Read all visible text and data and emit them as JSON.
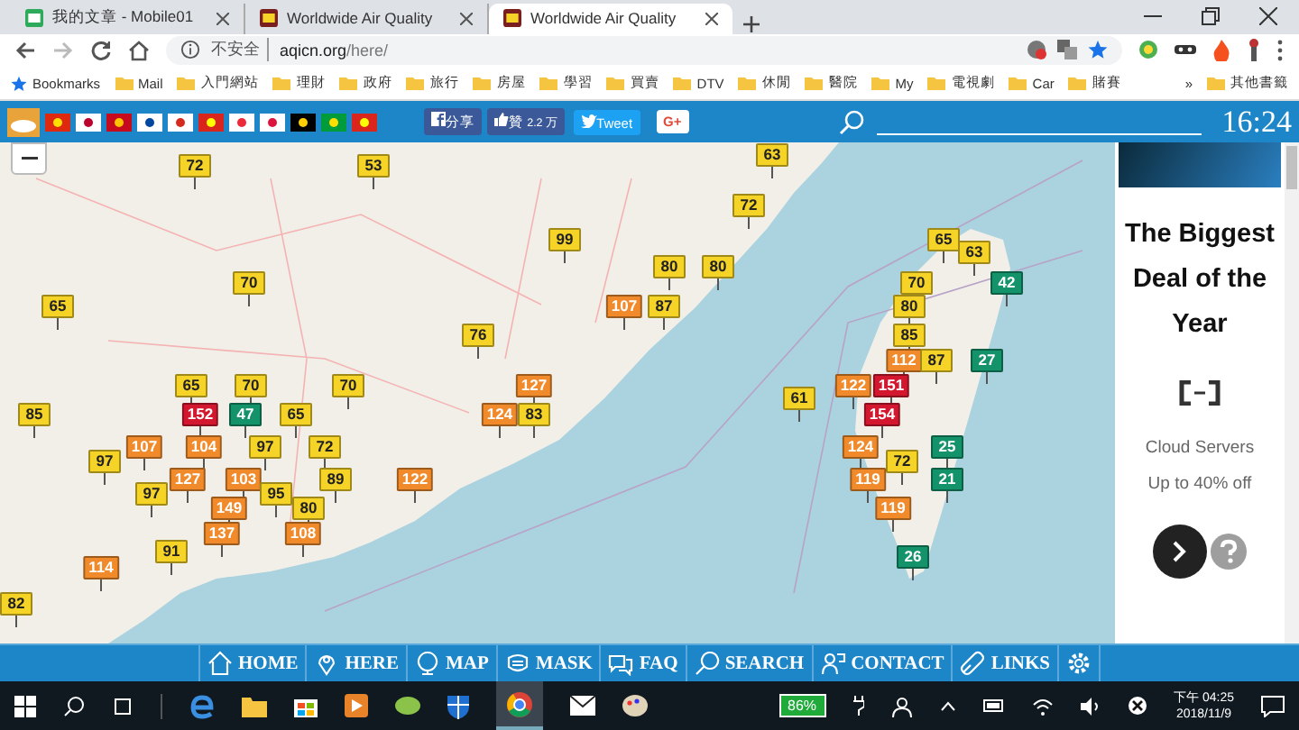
{
  "browser": {
    "tabs": [
      {
        "title": "我的文章 - Mobile01",
        "selected": false
      },
      {
        "title": "Worldwide Air Quality",
        "selected": false
      },
      {
        "title": "Worldwide Air Quality",
        "selected": true
      }
    ],
    "address": {
      "security": "不安全",
      "host": "aqicn.org",
      "path": "/here/"
    },
    "bookmarks": [
      "Mail",
      "入門網站",
      "理財",
      "政府",
      "旅行",
      "房屋",
      "學習",
      "買賣",
      "DTV",
      "休閒",
      "醫院",
      "My",
      "電視劇",
      "Car",
      "賭賽"
    ],
    "bookmarks_label": "Bookmarks",
    "overflow": "»",
    "other_bookmarks": "其他書籤"
  },
  "site_bar": {
    "share": "分享",
    "like": "贊",
    "like_count": "2.2 万",
    "tweet": "Tweet",
    "gplus": "G+",
    "time": "16:24"
  },
  "map": {
    "markers": [
      {
        "value": "63",
        "color": "#f5d327"
      },
      {
        "value": "72",
        "color": "#f5d327"
      },
      {
        "value": "53",
        "color": "#f5d327"
      },
      {
        "value": "72",
        "color": "#f5d327"
      },
      {
        "value": "99",
        "color": "#f5d327"
      },
      {
        "value": "65",
        "color": "#f5d327"
      },
      {
        "value": "63",
        "color": "#f5d327"
      },
      {
        "value": "80",
        "color": "#f5d327"
      },
      {
        "value": "80",
        "color": "#f5d327"
      },
      {
        "value": "70",
        "color": "#f5d327"
      },
      {
        "value": "70",
        "color": "#f5d327"
      },
      {
        "value": "42",
        "color": "#14936a"
      },
      {
        "value": "65",
        "color": "#f5d327"
      },
      {
        "value": "107",
        "color": "#f08a2a"
      },
      {
        "value": "87",
        "color": "#f5d327"
      },
      {
        "value": "80",
        "color": "#f5d327"
      },
      {
        "value": "76",
        "color": "#f5d327"
      },
      {
        "value": "85",
        "color": "#f5d327"
      },
      {
        "value": "112",
        "color": "#f08a2a"
      },
      {
        "value": "87",
        "color": "#f5d327"
      },
      {
        "value": "27",
        "color": "#14936a"
      },
      {
        "value": "65",
        "color": "#f5d327"
      },
      {
        "value": "70",
        "color": "#f5d327"
      },
      {
        "value": "70",
        "color": "#f5d327"
      },
      {
        "value": "127",
        "color": "#f08a2a"
      },
      {
        "value": "122",
        "color": "#f08a2a"
      },
      {
        "value": "151",
        "color": "#d3172e"
      },
      {
        "value": "61",
        "color": "#f5d327"
      },
      {
        "value": "85",
        "color": "#f5d327"
      },
      {
        "value": "152",
        "color": "#d3172e"
      },
      {
        "value": "47",
        "color": "#14936a"
      },
      {
        "value": "65",
        "color": "#f5d327"
      },
      {
        "value": "124",
        "color": "#f08a2a"
      },
      {
        "value": "83",
        "color": "#f5d327"
      },
      {
        "value": "154",
        "color": "#d3172e"
      },
      {
        "value": "107",
        "color": "#f08a2a"
      },
      {
        "value": "104",
        "color": "#f08a2a"
      },
      {
        "value": "97",
        "color": "#f5d327"
      },
      {
        "value": "72",
        "color": "#f5d327"
      },
      {
        "value": "124",
        "color": "#f08a2a"
      },
      {
        "value": "25",
        "color": "#14936a"
      },
      {
        "value": "97",
        "color": "#f5d327"
      },
      {
        "value": "72",
        "color": "#f5d327"
      },
      {
        "value": "127",
        "color": "#f08a2a"
      },
      {
        "value": "103",
        "color": "#f08a2a"
      },
      {
        "value": "89",
        "color": "#f5d327"
      },
      {
        "value": "122",
        "color": "#f08a2a"
      },
      {
        "value": "119",
        "color": "#f08a2a"
      },
      {
        "value": "21",
        "color": "#14936a"
      },
      {
        "value": "97",
        "color": "#f5d327"
      },
      {
        "value": "95",
        "color": "#f5d327"
      },
      {
        "value": "149",
        "color": "#f08a2a"
      },
      {
        "value": "80",
        "color": "#f5d327"
      },
      {
        "value": "119",
        "color": "#f08a2a"
      },
      {
        "value": "137",
        "color": "#f08a2a"
      },
      {
        "value": "108",
        "color": "#f08a2a"
      },
      {
        "value": "91",
        "color": "#f5d327"
      },
      {
        "value": "26",
        "color": "#14936a"
      },
      {
        "value": "114",
        "color": "#f08a2a"
      },
      {
        "value": "82",
        "color": "#f5d327"
      }
    ]
  },
  "ad": {
    "headline": "The Biggest Deal of the Year",
    "line1": "Cloud Servers",
    "line2": "Up to 40% off"
  },
  "nav": [
    {
      "label": "HOME",
      "kind": "home"
    },
    {
      "label": "HERE",
      "kind": "pin"
    },
    {
      "label": "MAP",
      "kind": "globe"
    },
    {
      "label": "MASK",
      "kind": "mask"
    },
    {
      "label": "FAQ",
      "kind": "chat"
    },
    {
      "label": "SEARCH",
      "kind": "search"
    },
    {
      "label": "CONTACT",
      "kind": "person"
    },
    {
      "label": "LINKS",
      "kind": "link"
    }
  ],
  "taskbar": {
    "battery": "86%",
    "time": "下午 04:25",
    "date": "2018/11/9"
  }
}
